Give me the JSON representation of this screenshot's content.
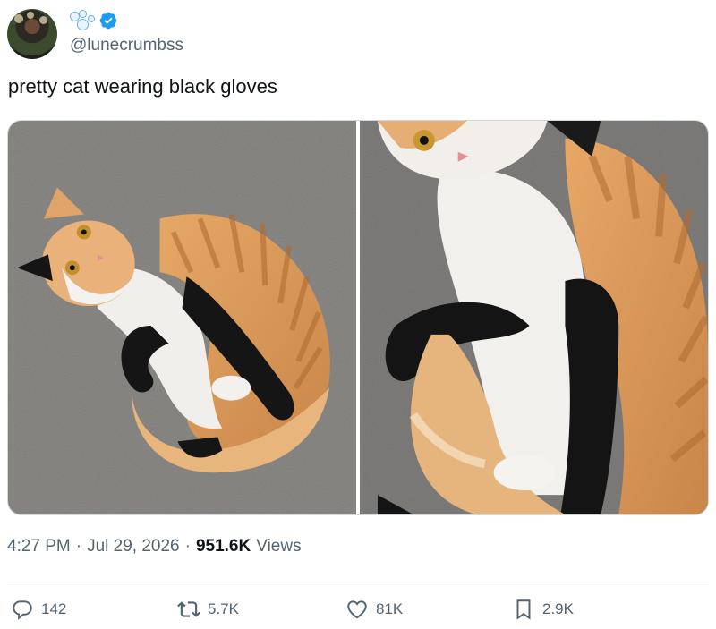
{
  "author": {
    "handle": "@lunecrumbss",
    "badge_icon": "bubbles-icon",
    "verified_icon": "verified-badge-icon"
  },
  "tweet": {
    "text": "pretty cat wearing black gloves"
  },
  "media": {
    "images": [
      {
        "alt": "cat-photo-1"
      },
      {
        "alt": "cat-photo-2"
      }
    ]
  },
  "meta": {
    "time": "4:27 PM",
    "separator": "·",
    "date": "Jul 29, 2026",
    "views_count": "951.6K",
    "views_label": "Views"
  },
  "actions": {
    "replies": "142",
    "reposts": "5.7K",
    "likes": "81K",
    "bookmarks": "2.9K"
  },
  "colors": {
    "text_primary": "#0f1419",
    "text_secondary": "#536471",
    "verified_blue": "#1d9bf0",
    "border": "#cfd9de"
  }
}
